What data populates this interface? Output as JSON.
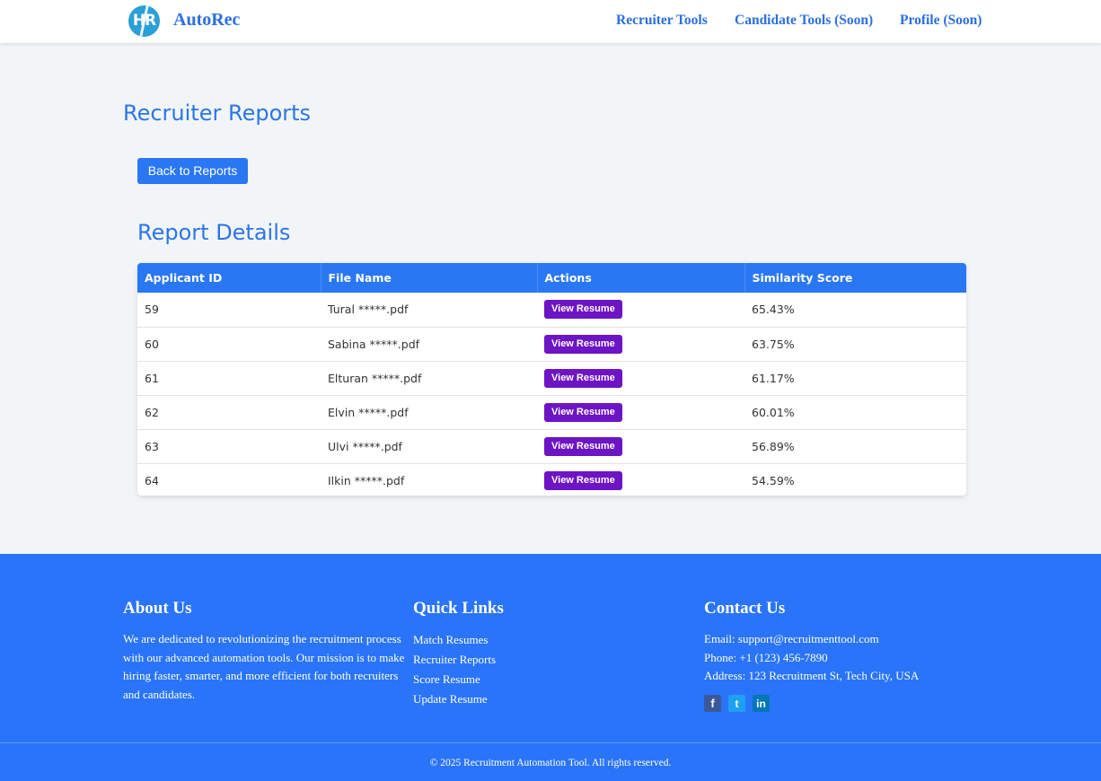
{
  "header": {
    "logo_text": "HR",
    "brand": "AutoRec",
    "nav": [
      "Recruiter Tools",
      "Candidate Tools (Soon)",
      "Profile (Soon)"
    ]
  },
  "main": {
    "page_title": "Recruiter Reports",
    "back_button": "Back to Reports",
    "section_title": "Report Details",
    "table": {
      "columns": [
        "Applicant ID",
        "File Name",
        "Actions",
        "Similarity Score"
      ],
      "action_label": "View Resume",
      "rows": [
        {
          "id": "59",
          "file": "Tural *****.pdf",
          "score": "65.43%"
        },
        {
          "id": "60",
          "file": "Sabina *****.pdf",
          "score": "63.75%"
        },
        {
          "id": "61",
          "file": "Elturan *****.pdf",
          "score": "61.17%"
        },
        {
          "id": "62",
          "file": "Elvin *****.pdf",
          "score": "60.01%"
        },
        {
          "id": "63",
          "file": "Ulvi *****.pdf",
          "score": "56.89%"
        },
        {
          "id": "64",
          "file": "Ilkin *****.pdf",
          "score": "54.59%"
        }
      ]
    }
  },
  "footer": {
    "about": {
      "title": "About Us",
      "text": "We are dedicated to revolutionizing the recruitment process with our advanced automation tools. Our mission is to make hiring faster, smarter, and more efficient for both recruiters and candidates."
    },
    "links": {
      "title": "Quick Links",
      "items": [
        "Match Resumes",
        "Recruiter Reports",
        "Score Resume",
        "Update Resume"
      ]
    },
    "contact": {
      "title": "Contact Us",
      "email": "Email: support@recruitmenttool.com",
      "phone": "Phone: +1 (123) 456-7890",
      "address": "Address: 123 Recruitment St, Tech City, USA"
    },
    "social": [
      "facebook-icon",
      "twitter-icon",
      "linkedin-icon"
    ],
    "social_glyphs": [
      "f",
      "t",
      "in"
    ],
    "copyright": "© 2025 Recruitment Automation Tool. All rights reserved."
  },
  "colors": {
    "accent": "#2a77f4",
    "title_blue": "#2b76e5",
    "action_purple": "#6d14c4",
    "footer_bg": "#2a74fa"
  }
}
